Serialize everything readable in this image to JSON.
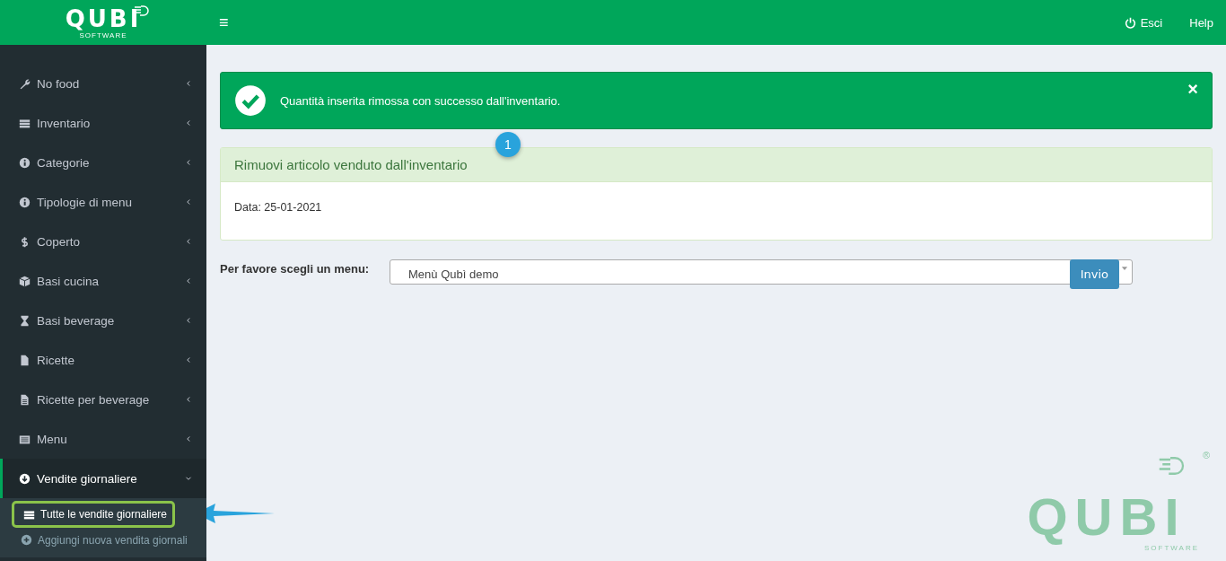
{
  "logo": {
    "name": "QUBI",
    "tagline": "SOFTWARE"
  },
  "topbar": {
    "menu_toggle": "≡",
    "links": [
      {
        "label": "Esci",
        "kind": "power"
      },
      {
        "label": "Help",
        "kind": "plain"
      }
    ]
  },
  "sidebar": {
    "items": [
      {
        "label": "No food",
        "expanded": false,
        "selected": false
      },
      {
        "label": "Inventario",
        "expanded": false,
        "selected": false
      },
      {
        "label": "Categorie",
        "expanded": false,
        "selected": false
      },
      {
        "label": "Tipologie di menu",
        "expanded": false,
        "selected": false
      },
      {
        "label": "Coperto",
        "expanded": false,
        "selected": false
      },
      {
        "label": "Basi cucina",
        "expanded": false,
        "selected": false
      },
      {
        "label": "Basi beverage",
        "expanded": false,
        "selected": false
      },
      {
        "label": "Ricette",
        "expanded": false,
        "selected": false
      },
      {
        "label": "Ricette per beverage",
        "expanded": false,
        "selected": false
      },
      {
        "label": "Menu",
        "expanded": false,
        "selected": false
      },
      {
        "label": "Vendite giornaliere",
        "expanded": true,
        "selected": true,
        "children": [
          {
            "label": "Tutte le vendite giornaliere",
            "selected": true,
            "highlighted": true
          },
          {
            "label": "Aggiungi nuova vendita giornali",
            "selected": false,
            "highlighted": false
          }
        ]
      }
    ]
  },
  "alert": {
    "message": "Quantità inserita rimossa con successo dall'inventario.",
    "close": "×"
  },
  "step_badge": "1",
  "panel": {
    "title": "Rimuovi articolo venduto dall'inventario",
    "date": "Data: 25-01-2021"
  },
  "form": {
    "label": "Per favore scegli un menu:",
    "value": "Menù Qubì demo",
    "button": "Invio"
  },
  "background_logo": {
    "name": "QUBI",
    "tagline": "SOFTWARE",
    "mark": "®"
  }
}
